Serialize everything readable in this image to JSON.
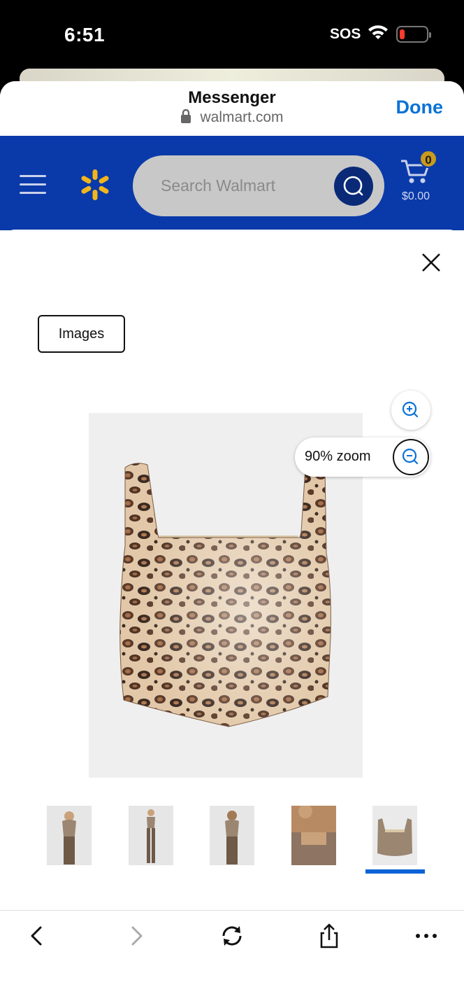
{
  "status": {
    "time": "6:51",
    "carrier": "SOS"
  },
  "browser": {
    "title": "Messenger",
    "url": "walmart.com",
    "done_label": "Done"
  },
  "walmart": {
    "search_placeholder": "Search Walmart",
    "cart_count": "0",
    "cart_total": "$0.00",
    "colors": {
      "brand_blue": "#0a3aa9",
      "spark_yellow": "#f2b51c",
      "link_blue": "#0a72d6"
    }
  },
  "viewer": {
    "tab_label": "Images",
    "zoom_label": "90% zoom",
    "zoom_percent": 90,
    "thumbnails": [
      "model-front-thumbnail",
      "model-full-thumbnail",
      "model-back-thumbnail",
      "neckline-closeup-thumbnail",
      "product-flat-thumbnail"
    ],
    "selected_thumbnail": 4
  },
  "icons": [
    "lock-icon",
    "menu-icon",
    "walmart-spark-icon",
    "search-icon",
    "cart-icon",
    "close-icon",
    "zoom-in-icon",
    "zoom-out-icon",
    "back-icon",
    "forward-icon",
    "reload-icon",
    "share-icon",
    "more-icon"
  ]
}
